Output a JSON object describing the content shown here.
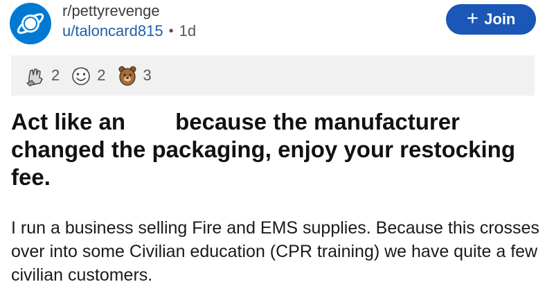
{
  "header": {
    "subreddit": "r/pettyrevenge",
    "author": "u/taloncard815",
    "separator": "•",
    "age": "1d",
    "join_label": "Join",
    "join_plus": "+"
  },
  "awards": [
    {
      "icon": "rock-hand-award-icon",
      "count": "2"
    },
    {
      "icon": "smile-face-award-icon",
      "count": "2"
    },
    {
      "icon": "bear-award-icon",
      "count": "3"
    }
  ],
  "post": {
    "title_part1": "Act like an",
    "title_part2": "because the manufacturer changed the packaging, enjoy your restocking fee.",
    "body": "I run a business selling Fire and EMS supplies.  Because this crosses over into some Civilian education (CPR training) we have quite a few civilian customers."
  },
  "colors": {
    "accent": "#1a57b6",
    "subreddit_avatar": "#0079d3",
    "award_bar": "#f1f1f2",
    "author_link": "#1f5fa6"
  }
}
